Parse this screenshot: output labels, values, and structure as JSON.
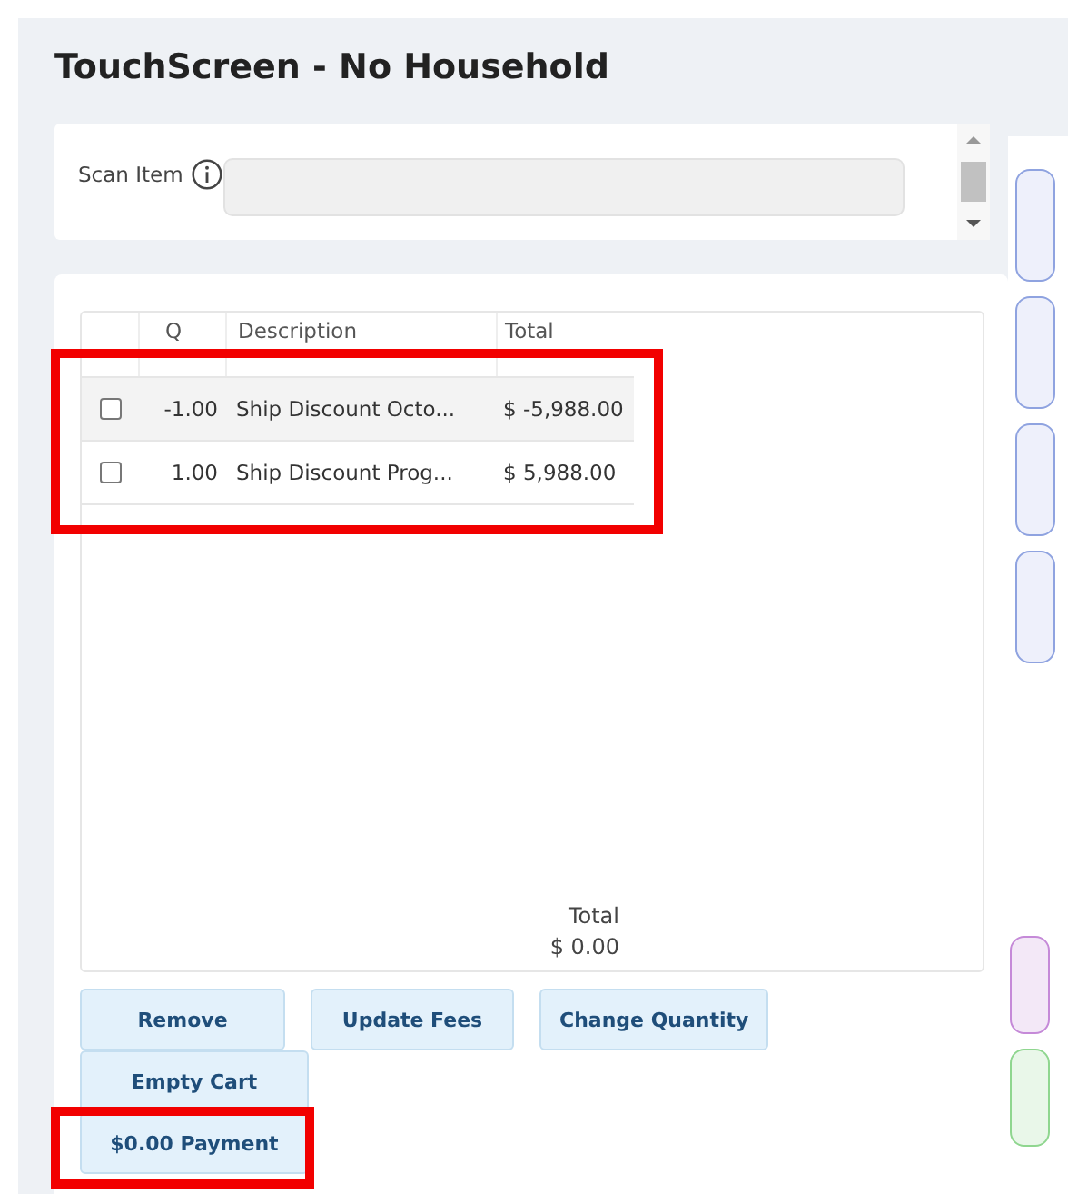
{
  "title": "TouchScreen - No Household",
  "scan": {
    "label": "Scan Item"
  },
  "cart": {
    "columns": [
      "Q",
      "Description",
      "Total"
    ],
    "highlighted": true,
    "rows": [
      {
        "checked": false,
        "qty": "-1.00",
        "description": "Ship Discount Octo...",
        "total": "$ -5,988.00"
      },
      {
        "checked": false,
        "qty": "1.00",
        "description": "Ship Discount Prog...",
        "total": "$ 5,988.00"
      }
    ],
    "total_label": "Total",
    "total_value": "$ 0.00"
  },
  "buttons": [
    {
      "label": "Remove",
      "highlighted": false
    },
    {
      "label": "Update Fees",
      "highlighted": false
    },
    {
      "label": "Change Quantity",
      "highlighted": false
    },
    {
      "label": "Empty Cart",
      "highlighted": false
    },
    {
      "label": "$0.00 Payment",
      "highlighted": true
    }
  ],
  "side_buttons": [
    {
      "color": "#8fa3e0"
    },
    {
      "color": "#8fa3e0"
    },
    {
      "color": "#8fa3e0"
    },
    {
      "color": "#8fa3e0"
    },
    {
      "color": "#c58ad8"
    },
    {
      "color": "#8fd68f"
    }
  ]
}
